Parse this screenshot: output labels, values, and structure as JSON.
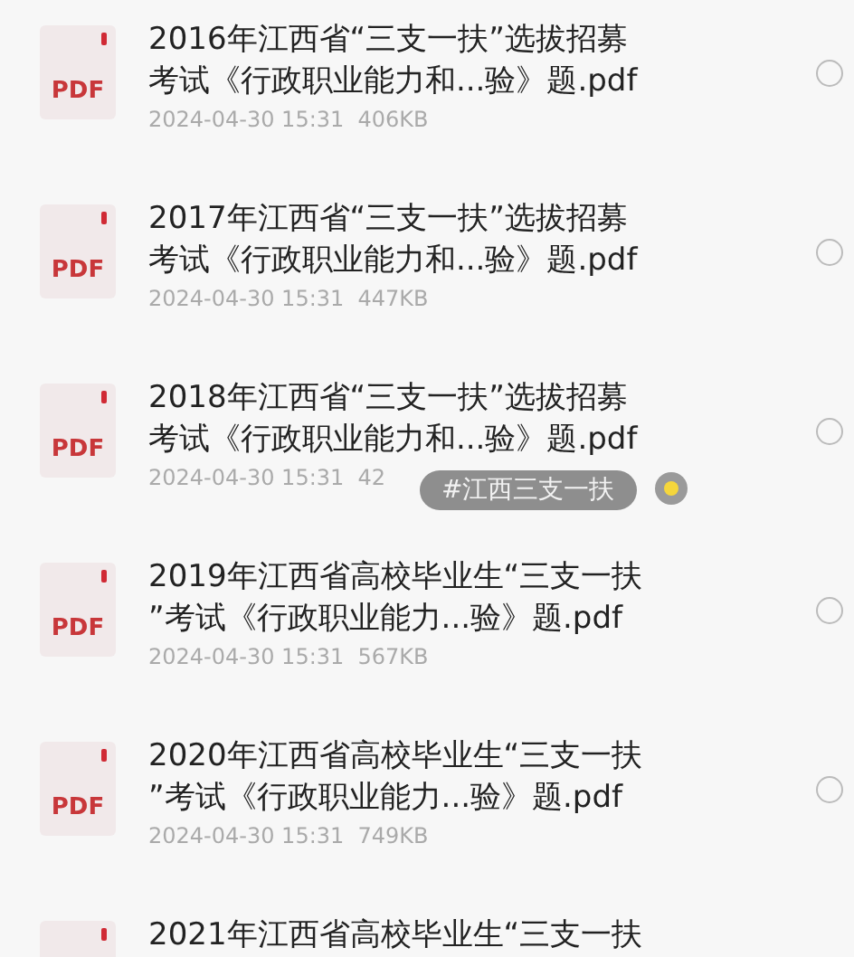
{
  "files": [
    {
      "icon_label": "PDF",
      "title_lines": [
        "2016年江西省“三支一扶”选拔招募",
        "考试《行政职业能力和...验》题.pdf"
      ],
      "meta": "2024-04-30 15:31  406KB",
      "selected": false
    },
    {
      "icon_label": "PDF",
      "title_lines": [
        "2017年江西省“三支一扶”选拔招募",
        "考试《行政职业能力和...验》题.pdf"
      ],
      "meta": "2024-04-30 15:31  447KB",
      "selected": false
    },
    {
      "icon_label": "PDF",
      "title_lines": [
        "2018年江西省“三支一扶”选拔招募",
        "考试《行政职业能力和...验》题.pdf"
      ],
      "meta": "2024-04-30 15:31  42",
      "selected": false,
      "tag": "#江西三支一扶"
    },
    {
      "icon_label": "PDF",
      "title_lines": [
        "2019年江西省高校毕业生“三支一扶",
        "”考试《行政职业能力...验》题.pdf"
      ],
      "meta": "2024-04-30 15:31  567KB",
      "selected": false
    },
    {
      "icon_label": "PDF",
      "title_lines": [
        "2020年江西省高校毕业生“三支一扶",
        "”考试《行政职业能力...验》题.pdf"
      ],
      "meta": "2024-04-30 15:31  749KB",
      "selected": false
    },
    {
      "title_lines": [
        "2021年江西省高校毕业生“三支一扶"
      ]
    }
  ]
}
